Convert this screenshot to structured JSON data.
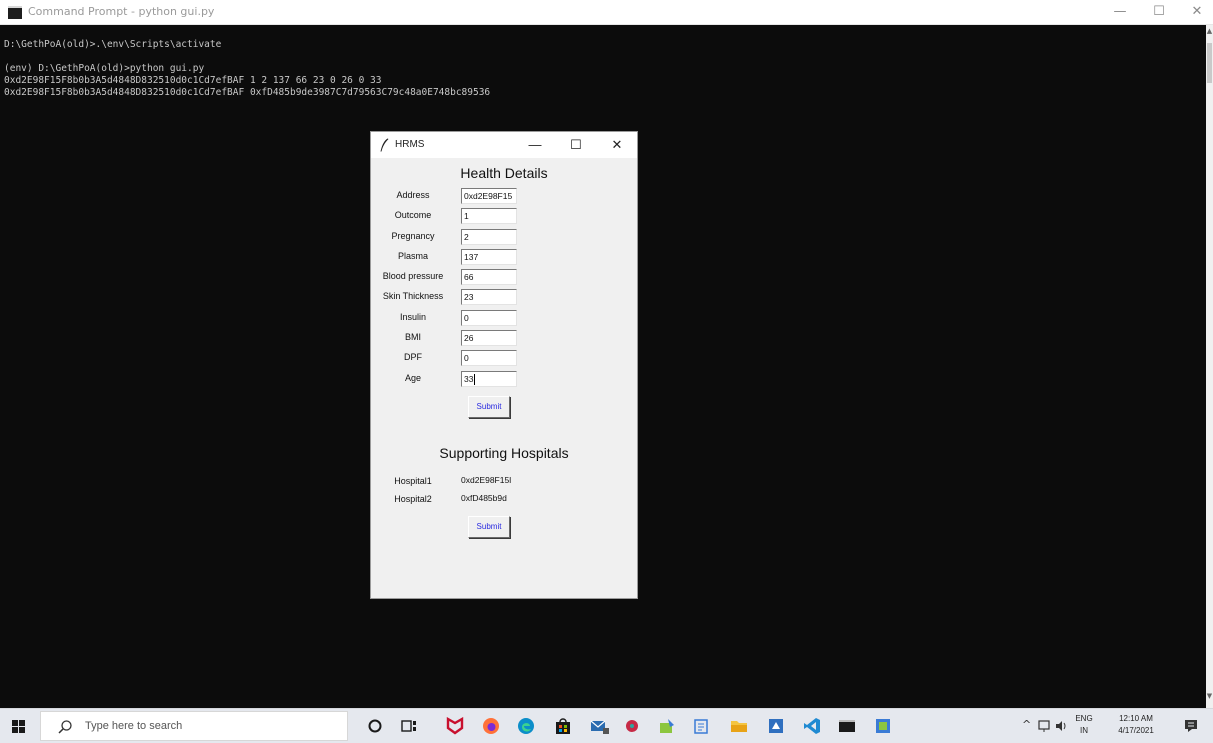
{
  "console_window": {
    "title": "Command Prompt - python gui.py",
    "controls": {
      "minimize": "—",
      "maximize": "☐",
      "close": "✕"
    },
    "lines": [
      "D:\\GethPoA(old)>.\\env\\Scripts\\activate",
      "",
      "(env) D:\\GethPoA(old)>python gui.py",
      "0xd2E98F15F8b0b3A5d4848D832510d0c1Cd7efBAF 1 2 137 66 23 0 26 0 33",
      "0xd2E98F15F8b0b3A5d4848D832510d0c1Cd7efBAF 0xfD485b9de3987C7d79563C79c48a0E748bc89536"
    ]
  },
  "app_window": {
    "title": "HRMS",
    "controls": {
      "minimize": "—",
      "maximize": "☐",
      "close": "✕"
    },
    "health_section": {
      "title": "Health Details",
      "fields": [
        {
          "label": "Address",
          "value": "0xd2E98F15"
        },
        {
          "label": "Outcome",
          "value": "1"
        },
        {
          "label": "Pregnancy",
          "value": "2"
        },
        {
          "label": "Plasma",
          "value": "137"
        },
        {
          "label": "Blood pressure",
          "value": "66"
        },
        {
          "label": "Skin Thickness",
          "value": "23"
        },
        {
          "label": "Insulin",
          "value": "0"
        },
        {
          "label": "BMI",
          "value": "26"
        },
        {
          "label": "DPF",
          "value": "0"
        },
        {
          "label": "Age",
          "value": "33"
        }
      ],
      "submit_label": "Submit"
    },
    "hospitals_section": {
      "title": "Supporting Hospitals",
      "hospitals": [
        {
          "label": "Hospital1",
          "value": "0xd2E98F15l"
        },
        {
          "label": "Hospital2",
          "value": "0xfD485b9d"
        }
      ],
      "submit_label": "Submit"
    }
  },
  "taskbar": {
    "search_placeholder": "Type here to search",
    "pinned_icons": [
      "cortana-icon",
      "task-view-icon",
      "mcafee-icon",
      "firefox-icon",
      "edge-icon",
      "store-icon",
      "mail-icon",
      "app-icon",
      "paint-icon",
      "notepadpp-icon",
      "file-explorer-icon",
      "azure-icon",
      "vscode-icon",
      "command-prompt-icon",
      "app-icon-2"
    ],
    "tray": {
      "chevron": "^",
      "language": "ENG",
      "region": "IN",
      "time": "12:10 AM",
      "date": "4/17/2021"
    }
  },
  "colors": {
    "console_bg": "#0c0c0c",
    "console_text": "#c8c8c8",
    "tk_bg": "#f0f0f0",
    "button_text": "#2a2ae0",
    "taskbar_bg": "#e5e8ee"
  }
}
